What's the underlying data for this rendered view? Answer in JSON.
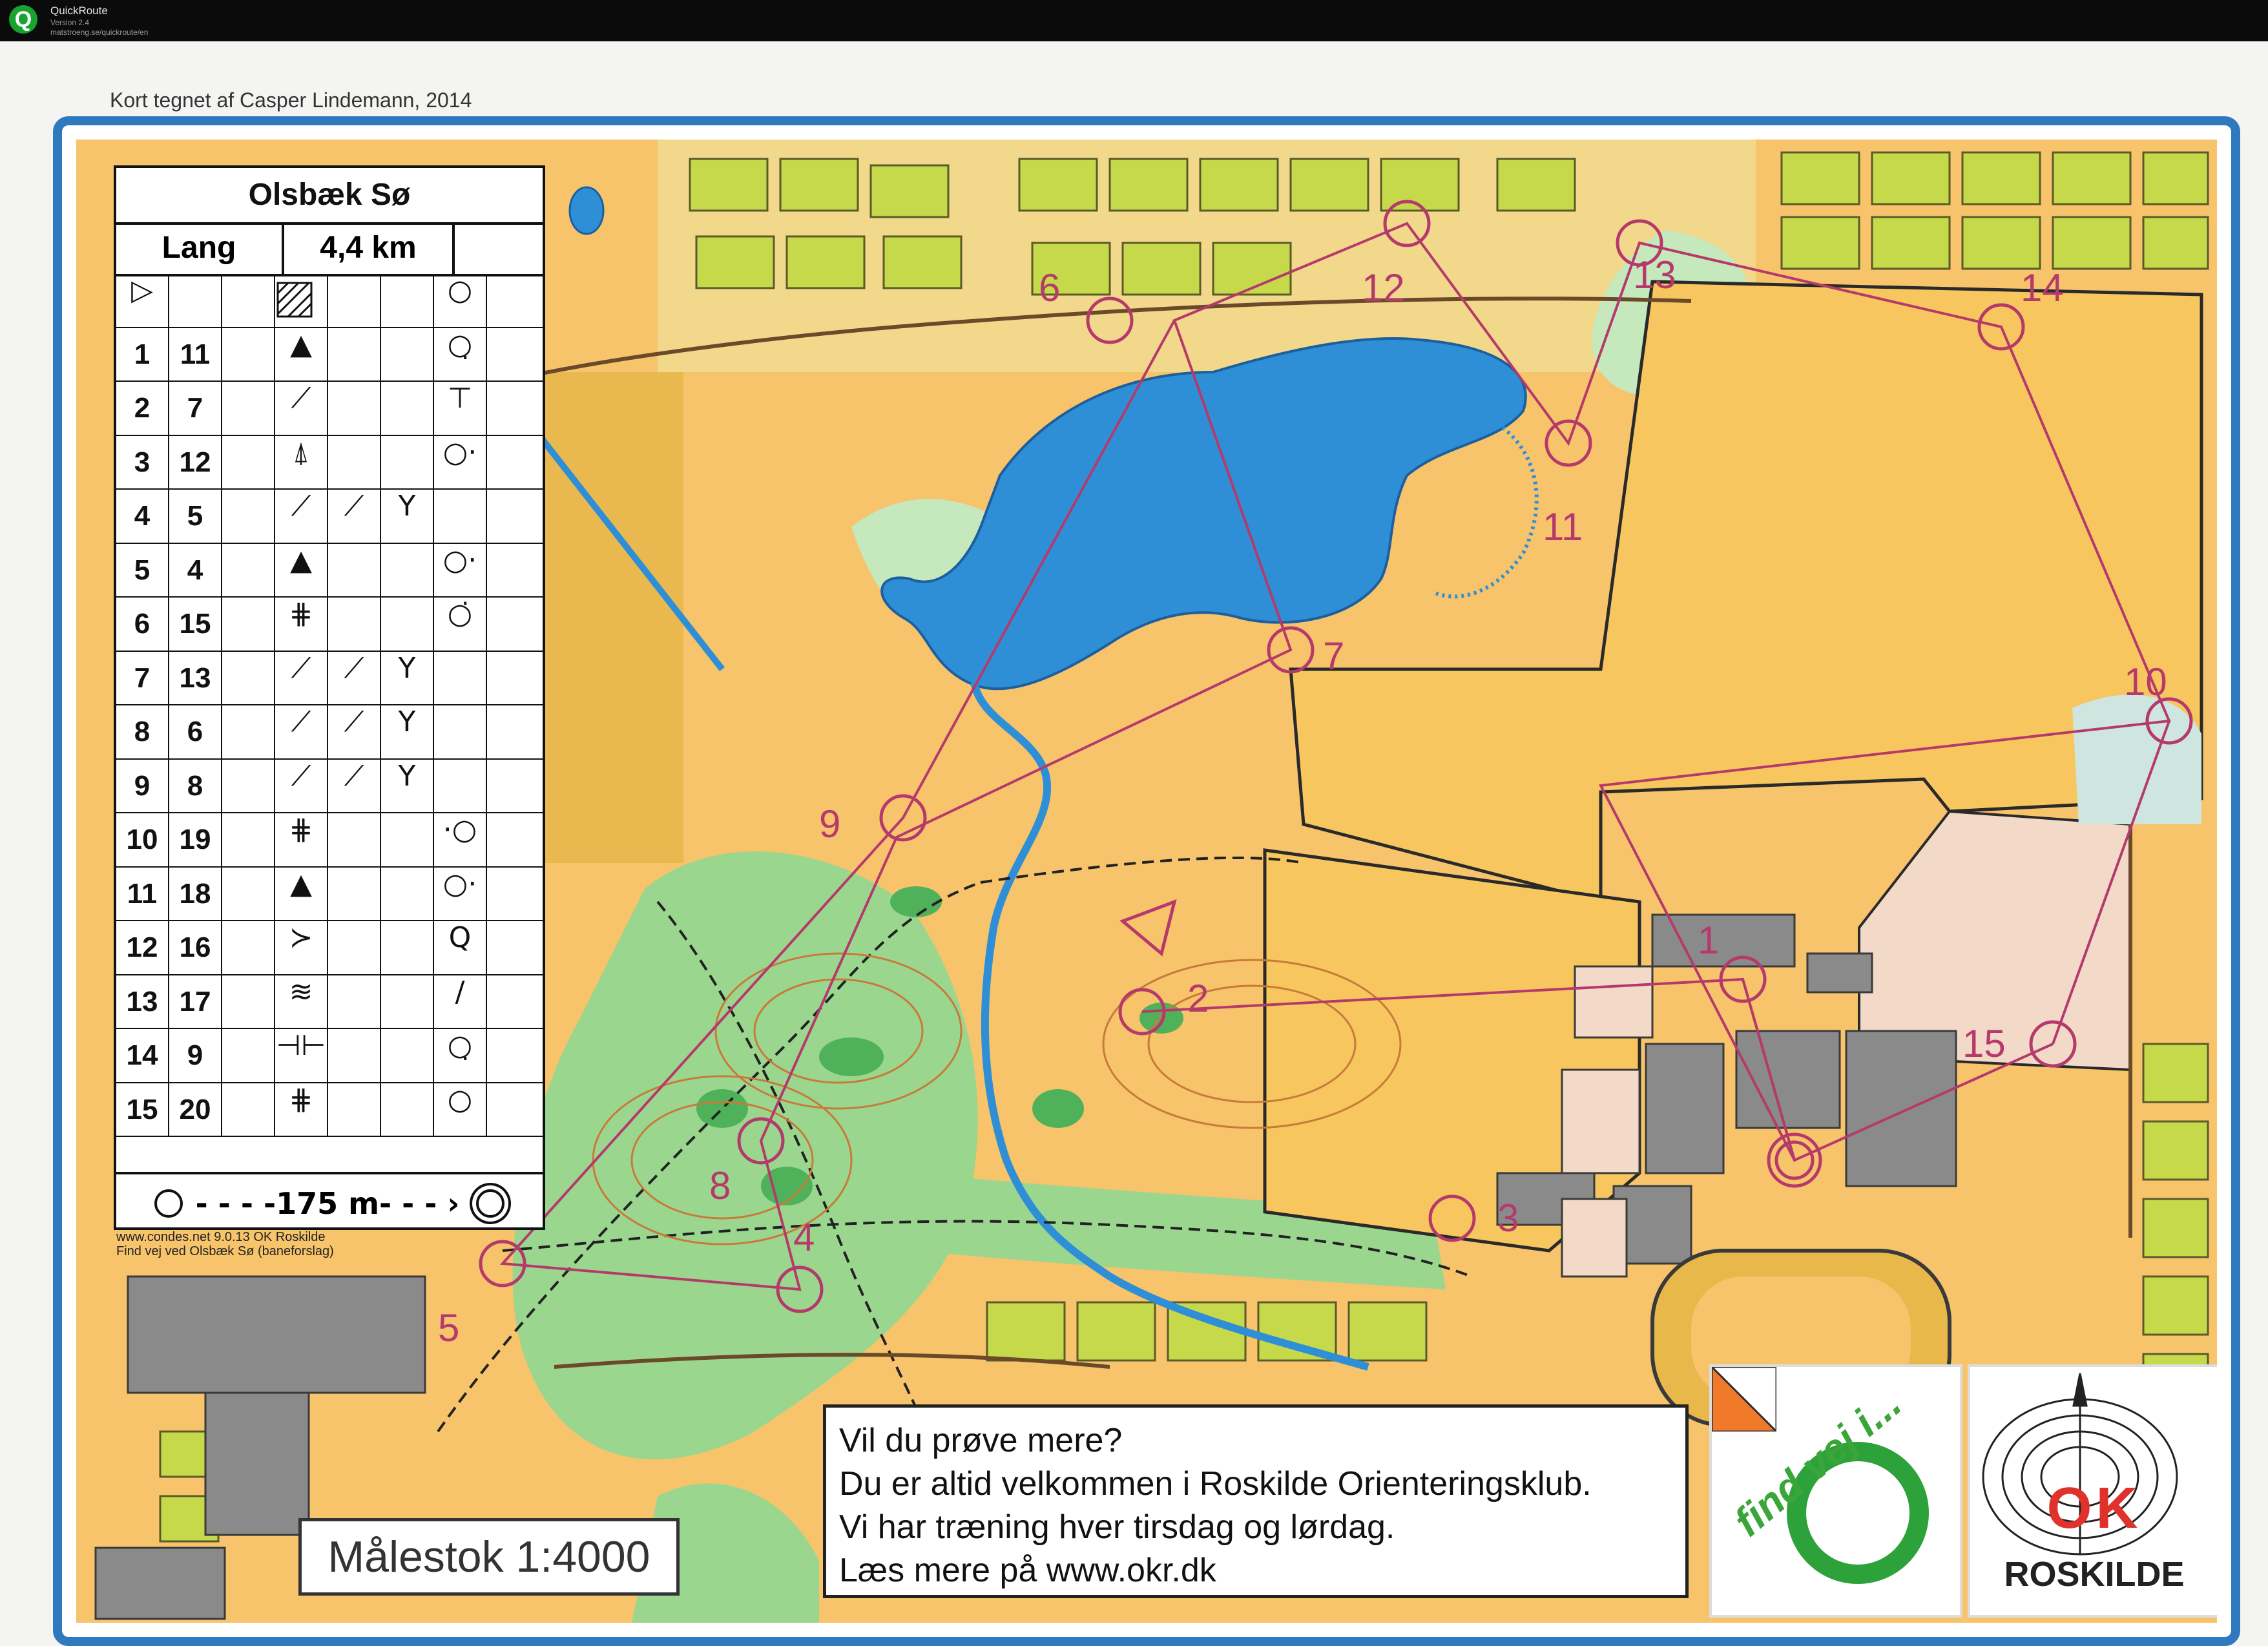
{
  "app": {
    "name": "QuickRoute",
    "version": "Version 2.4",
    "url": "matstroeng.se/quickroute/en"
  },
  "map": {
    "credit": "Kort tegnet af Casper Lindemann, 2014",
    "title": "Olsbæk Sø",
    "course_class": "Lang",
    "course_length": "4,4 km",
    "scale": "Målestok 1:4000",
    "small_print": [
      "www.condes.net 9.0.13 OK Roskilde",
      "Find vej ved Olsbæk Sø (baneforslag)"
    ],
    "finish_distance": "175 m",
    "control_descriptions": [
      {
        "seq": "1",
        "code": "11",
        "c": "▲",
        "f": "",
        "g": "",
        "h": "○̣"
      },
      {
        "seq": "2",
        "code": "7",
        "c": "⟋",
        "f": "",
        "g": "",
        "h": "⊤"
      },
      {
        "seq": "3",
        "code": "12",
        "c": "⍋",
        "f": "",
        "g": "",
        "h": "○·"
      },
      {
        "seq": "4",
        "code": "5",
        "c": "⟋",
        "f": "⟋",
        "g": "Y",
        "h": ""
      },
      {
        "seq": "5",
        "code": "4",
        "c": "▲",
        "f": "",
        "g": "",
        "h": "○·"
      },
      {
        "seq": "6",
        "code": "15",
        "c": "⋕",
        "f": "",
        "g": "",
        "h": "○̇"
      },
      {
        "seq": "7",
        "code": "13",
        "c": "⟋",
        "f": "⟋",
        "g": "Y",
        "h": ""
      },
      {
        "seq": "8",
        "code": "6",
        "c": "⟋",
        "f": "⟋",
        "g": "Y",
        "h": ""
      },
      {
        "seq": "9",
        "code": "8",
        "c": "⟋",
        "f": "⟋",
        "g": "Y",
        "h": ""
      },
      {
        "seq": "10",
        "code": "19",
        "c": "⋕",
        "f": "",
        "g": "",
        "h": "·○"
      },
      {
        "seq": "11",
        "code": "18",
        "c": "▲",
        "f": "",
        "g": "",
        "h": "○·"
      },
      {
        "seq": "12",
        "code": "16",
        "c": "≻",
        "f": "",
        "g": "",
        "h": "Q"
      },
      {
        "seq": "13",
        "code": "17",
        "c": "≋",
        "f": "",
        "g": "",
        "h": "/"
      },
      {
        "seq": "14",
        "code": "9",
        "c": "⊣⊢",
        "f": "",
        "g": "",
        "h": "○̣"
      },
      {
        "seq": "15",
        "code": "20",
        "c": "⋕",
        "f": "",
        "g": "",
        "h": "○"
      }
    ],
    "start_symbol": "▷",
    "control_labels": [
      "1",
      "2",
      "3",
      "4",
      "5",
      "6",
      "7",
      "8",
      "9",
      "10",
      "11",
      "12",
      "13",
      "14",
      "15"
    ]
  },
  "info_box": {
    "lines": [
      "Vil du prøve mere?",
      "Du er altid velkommen i Roskilde Orienteringsklub.",
      "Vi har træning hver tirsdag og lørdag.",
      "Læs mere på www.okr.dk"
    ]
  },
  "logos": {
    "find_vej": "find vej i...",
    "ok_letters": "OK",
    "club": "ROSKILDE"
  },
  "colors": {
    "frame": "#2f79be",
    "course": "#b53a6b",
    "water": "#2f8fd6",
    "forest": "#8fcf86",
    "open": "#f7c36b"
  }
}
